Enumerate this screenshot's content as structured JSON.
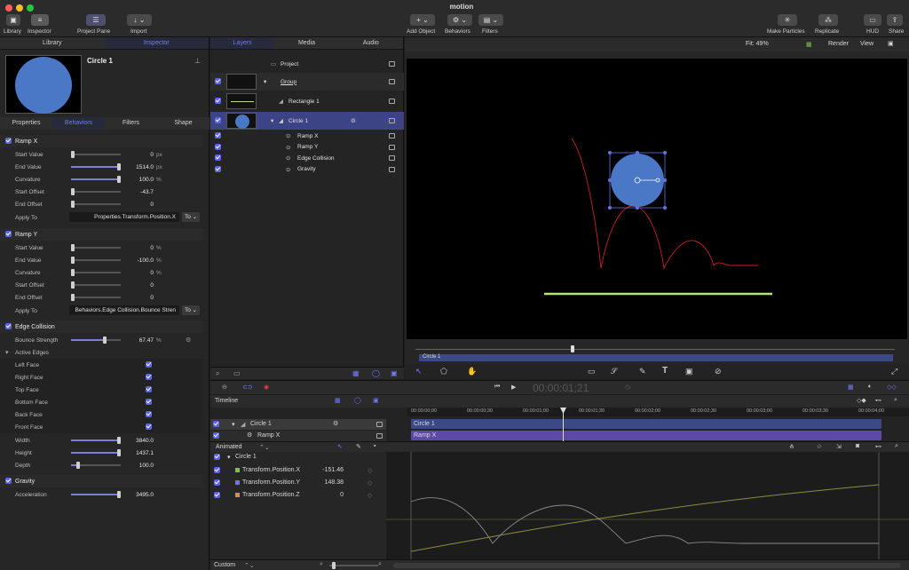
{
  "app": {
    "title": "motion"
  },
  "toolbar": {
    "library": "Library",
    "inspector": "Inspector",
    "project_pane": "Project Pane",
    "import": "Import",
    "add_object": "Add Object",
    "behaviors": "Behaviors",
    "filters": "Filters",
    "make_particles": "Make Particles",
    "replicate": "Replicate",
    "hud": "HUD",
    "share": "Share"
  },
  "left_tabs": {
    "library": "Library",
    "inspector": "Inspector"
  },
  "preview": {
    "name": "Circle 1"
  },
  "inspector_tabs": [
    "Properties",
    "Behaviors",
    "Filters",
    "Shape"
  ],
  "ramp_x": {
    "title": "Ramp X",
    "rows": [
      {
        "label": "Start Value",
        "value": "0",
        "unit": "px"
      },
      {
        "label": "End Value",
        "value": "1514.0",
        "unit": "px"
      },
      {
        "label": "Curvature",
        "value": "100.0",
        "unit": "%"
      },
      {
        "label": "Start Offset",
        "value": "-43.7",
        "unit": ""
      },
      {
        "label": "End Offset",
        "value": "0",
        "unit": ""
      }
    ],
    "apply_to_label": "Apply To",
    "apply_to": "Properties.Transform.Position.X",
    "to": "To"
  },
  "ramp_y": {
    "title": "Ramp Y",
    "rows": [
      {
        "label": "Start Value",
        "value": "0",
        "unit": "%"
      },
      {
        "label": "End Value",
        "value": "-100.0",
        "unit": "%"
      },
      {
        "label": "Curvature",
        "value": "0",
        "unit": "%"
      },
      {
        "label": "Start Offset",
        "value": "0",
        "unit": ""
      },
      {
        "label": "End Offset",
        "value": "0",
        "unit": ""
      }
    ],
    "apply_to_label": "Apply To",
    "apply_to": "Behaviors.Edge Collision.Bounce Stren",
    "to": "To"
  },
  "edge_collision": {
    "title": "Edge Collision",
    "bounce_label": "Bounce Strength",
    "bounce_value": "67.47",
    "bounce_unit": "%",
    "active_edges": "Active Edges",
    "edges": [
      "Left Face",
      "Right Face",
      "Top Face",
      "Bottom Face",
      "Back Face",
      "Front Face"
    ],
    "dims": [
      {
        "label": "Width",
        "value": "3840.0"
      },
      {
        "label": "Height",
        "value": "1437.1"
      },
      {
        "label": "Depth",
        "value": "100.0"
      }
    ]
  },
  "gravity": {
    "title": "Gravity",
    "acc_label": "Acceleration",
    "acc_value": "3495.0"
  },
  "mid_tabs": [
    "Layers",
    "Media",
    "Audio"
  ],
  "layers": {
    "project": "Project",
    "group": "Group",
    "rect": "Rectangle 1",
    "circle": "Circle 1",
    "behaviors": [
      "Ramp X",
      "Ramp Y",
      "Edge Collision",
      "Gravity"
    ]
  },
  "canvas": {
    "fit": "Fit: 49%",
    "render": "Render",
    "view": "View",
    "mini_label": "Circle 1"
  },
  "transport": {
    "timecode": "00:00:01;21"
  },
  "timeline": {
    "title": "Timeline",
    "track_circle": "Circle 1",
    "track_ramp": "Ramp X",
    "bar_circle": "Circle 1",
    "bar_ramp": "Ramp X",
    "ticks": [
      "00:00:00;00",
      "00:00:00;30",
      "00:00:01;00",
      "00:00:01;30",
      "00:00:02;00",
      "00:00:02;30",
      "00:00:03;00",
      "00:00:03;30",
      "00:00:04;00"
    ],
    "animated": "Animated",
    "curve_group": "Circle 1",
    "curves": [
      {
        "label": "Transform.Position.X",
        "value": "-151.46",
        "color": "#7fbf4f"
      },
      {
        "label": "Transform.Position.Y",
        "value": "148.38",
        "color": "#7a6fe0"
      },
      {
        "label": "Transform.Position.Z",
        "value": "0",
        "color": "#e08a3c"
      }
    ],
    "custom": "Custom"
  }
}
